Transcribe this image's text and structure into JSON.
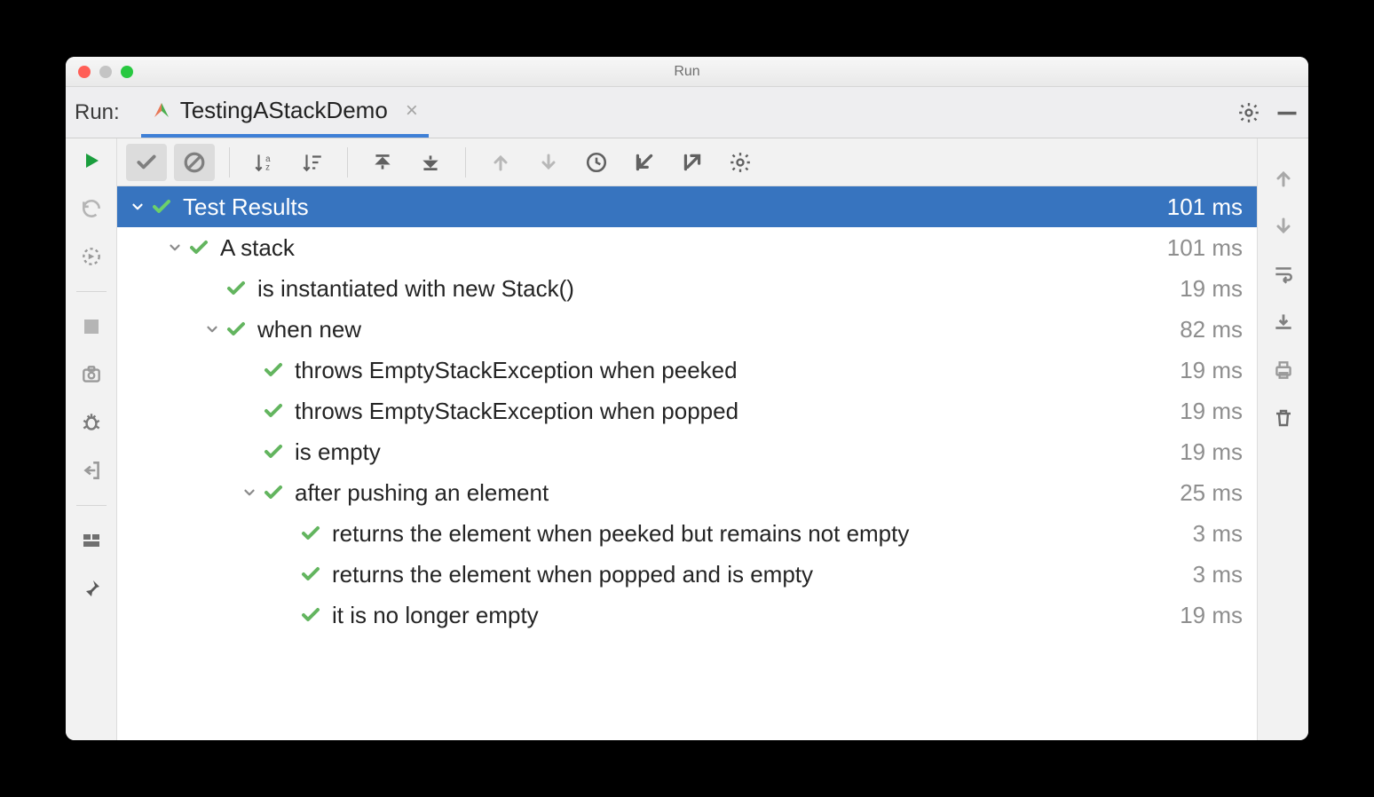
{
  "window": {
    "title": "Run"
  },
  "header": {
    "label": "Run:",
    "config_name": "TestingAStackDemo"
  },
  "tree": [
    {
      "depth": 0,
      "expandable": true,
      "label": "Test Results",
      "time": "101 ms",
      "root": true
    },
    {
      "depth": 1,
      "expandable": true,
      "label": "A stack",
      "time": "101 ms"
    },
    {
      "depth": 2,
      "expandable": false,
      "label": "is instantiated with new Stack()",
      "time": "19 ms"
    },
    {
      "depth": 2,
      "expandable": true,
      "label": "when new",
      "time": "82 ms"
    },
    {
      "depth": 3,
      "expandable": false,
      "label": "throws EmptyStackException when peeked",
      "time": "19 ms"
    },
    {
      "depth": 3,
      "expandable": false,
      "label": "throws EmptyStackException when popped",
      "time": "19 ms"
    },
    {
      "depth": 3,
      "expandable": false,
      "label": "is empty",
      "time": "19 ms"
    },
    {
      "depth": 3,
      "expandable": true,
      "label": "after pushing an element",
      "time": "25 ms"
    },
    {
      "depth": 4,
      "expandable": false,
      "label": "returns the element when peeked but remains not empty",
      "time": "3 ms"
    },
    {
      "depth": 4,
      "expandable": false,
      "label": "returns the element when popped and is empty",
      "time": "3 ms"
    },
    {
      "depth": 4,
      "expandable": false,
      "label": "it is no longer empty",
      "time": "19 ms"
    }
  ]
}
